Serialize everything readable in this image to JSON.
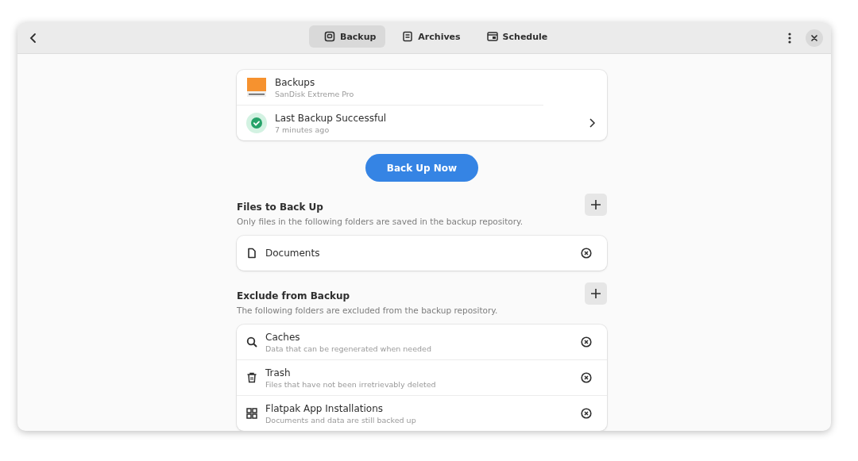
{
  "tabs": [
    {
      "label": "Backup",
      "kind": "backup",
      "selected": true
    },
    {
      "label": "Archives",
      "kind": "archives",
      "selected": false
    },
    {
      "label": "Schedule",
      "kind": "schedule",
      "selected": false
    }
  ],
  "repository": {
    "title": "Backups",
    "subtitle": "SanDisk Extreme Pro"
  },
  "status": {
    "title": "Last Backup Successful",
    "subtitle": "7 minutes ago"
  },
  "backup_button": "Back Up Now",
  "sections": [
    {
      "title": "Files to Back Up",
      "description": "Only files in the following folders are saved in the backup repository.",
      "items": [
        {
          "kind": "document",
          "title": "Documents"
        }
      ]
    },
    {
      "title": "Exclude from Backup",
      "description": "The following folders are excluded from the backup repository.",
      "items": [
        {
          "kind": "search",
          "title": "Caches",
          "subtitle": "Data that can be regenerated when needed"
        },
        {
          "kind": "trash",
          "title": "Trash",
          "subtitle": "Files that have not been irretrievably deleted"
        },
        {
          "kind": "grid",
          "title": "Flatpak App Installations",
          "subtitle": "Documents and data are still backed up"
        }
      ]
    }
  ]
}
